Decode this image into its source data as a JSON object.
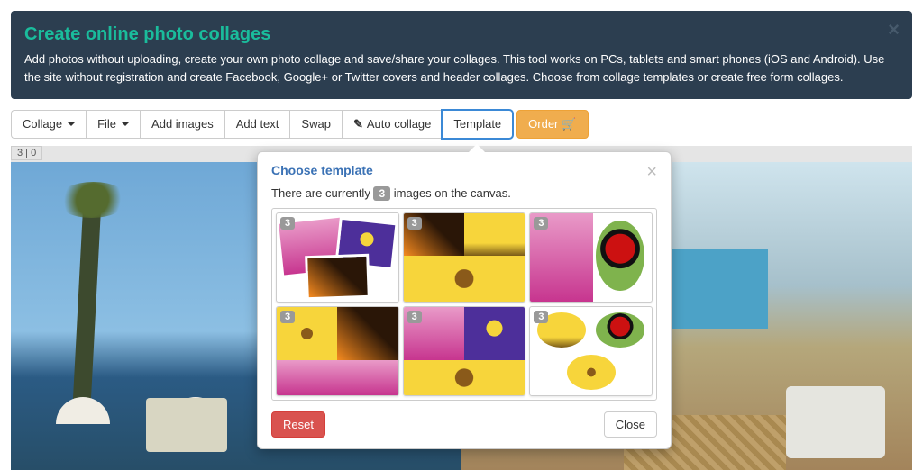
{
  "alert": {
    "title": "Create online photo collages",
    "body": "Add photos without uploading, create your own photo collage and save/share your collages. This tool works on PCs, tablets and smart phones (iOS and Android). Use the site without registration and create Facebook, Google+ or Twitter covers and header collages. Choose from collage templates or create free form collages."
  },
  "toolbar": {
    "collage": "Collage",
    "file": "File",
    "add_images": "Add images",
    "add_text": "Add text",
    "swap": "Swap",
    "auto_collage": "Auto collage",
    "template": "Template",
    "order": "Order"
  },
  "canvas": {
    "counter": "3 | 0"
  },
  "modal": {
    "title": "Choose template",
    "subtitle_pre": "There are currently",
    "image_count": "3",
    "subtitle_post": "images on the canvas.",
    "template_badge": "3",
    "reset": "Reset",
    "close": "Close"
  }
}
